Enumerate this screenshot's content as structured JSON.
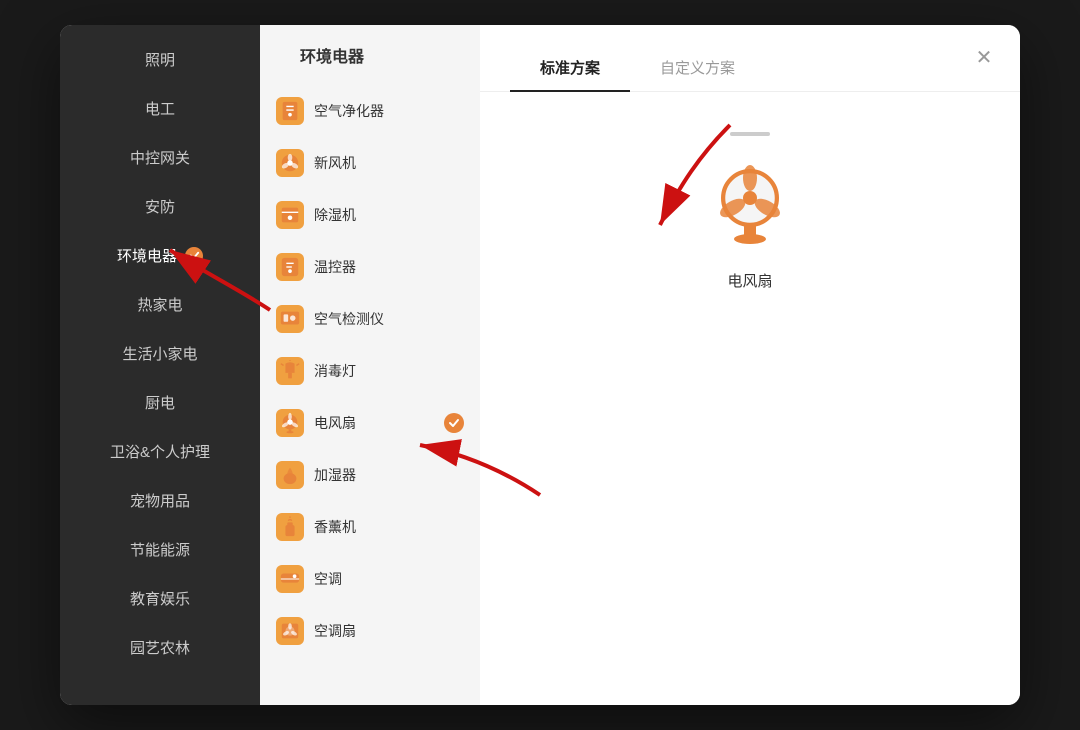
{
  "dialog": {
    "title": "环境电器",
    "close_label": "×",
    "tabs": [
      {
        "id": "standard",
        "label": "标准方案",
        "active": true
      },
      {
        "id": "custom",
        "label": "自定义方案",
        "active": false
      }
    ],
    "selected_device": {
      "name": "电风扇"
    }
  },
  "sidebar": {
    "items": [
      {
        "id": "lighting",
        "label": "照明",
        "active": false,
        "checked": false
      },
      {
        "id": "electrician",
        "label": "电工",
        "active": false,
        "checked": false
      },
      {
        "id": "gateway",
        "label": "中控网关",
        "active": false,
        "checked": false
      },
      {
        "id": "security",
        "label": "安防",
        "active": false,
        "checked": false
      },
      {
        "id": "env_appliance",
        "label": "环境电器",
        "active": true,
        "checked": true
      },
      {
        "id": "hot_appliance",
        "label": "热家电",
        "active": false,
        "checked": false
      },
      {
        "id": "small_appliance",
        "label": "生活小家电",
        "active": false,
        "checked": false
      },
      {
        "id": "kitchen",
        "label": "厨电",
        "active": false,
        "checked": false
      },
      {
        "id": "bathroom",
        "label": "卫浴&个人护理",
        "active": false,
        "checked": false
      },
      {
        "id": "pet",
        "label": "宠物用品",
        "active": false,
        "checked": false
      },
      {
        "id": "energy",
        "label": "节能能源",
        "active": false,
        "checked": false
      },
      {
        "id": "education",
        "label": "教育娱乐",
        "active": false,
        "checked": false
      },
      {
        "id": "garden",
        "label": "园艺农林",
        "active": false,
        "checked": false
      }
    ]
  },
  "categories": [
    {
      "id": "air_purifier",
      "label": "空气净化器",
      "checked": false,
      "icon": "purifier"
    },
    {
      "id": "fresh_air",
      "label": "新风机",
      "checked": false,
      "icon": "fan_circle"
    },
    {
      "id": "dehumidifier",
      "label": "除湿机",
      "checked": false,
      "icon": "box"
    },
    {
      "id": "thermostat",
      "label": "温控器",
      "checked": false,
      "icon": "temp"
    },
    {
      "id": "air_detector",
      "label": "空气检测仪",
      "checked": false,
      "icon": "detector"
    },
    {
      "id": "uv_lamp",
      "label": "消毒灯",
      "checked": false,
      "icon": "lamp"
    },
    {
      "id": "electric_fan",
      "label": "电风扇",
      "checked": true,
      "icon": "fan"
    },
    {
      "id": "humidifier",
      "label": "加湿器",
      "checked": false,
      "icon": "humidifier"
    },
    {
      "id": "aroma",
      "label": "香薰机",
      "checked": false,
      "icon": "aroma"
    },
    {
      "id": "ac",
      "label": "空调",
      "checked": false,
      "icon": "ac"
    },
    {
      "id": "ac_fan",
      "label": "空调扇",
      "checked": false,
      "icon": "ac_fan"
    }
  ],
  "colors": {
    "accent": "#e8843a",
    "sidebar_bg": "#2b2b2b",
    "middle_bg": "#f5f5f5",
    "active_text": "#ffffff",
    "inactive_text": "#cccccc"
  }
}
